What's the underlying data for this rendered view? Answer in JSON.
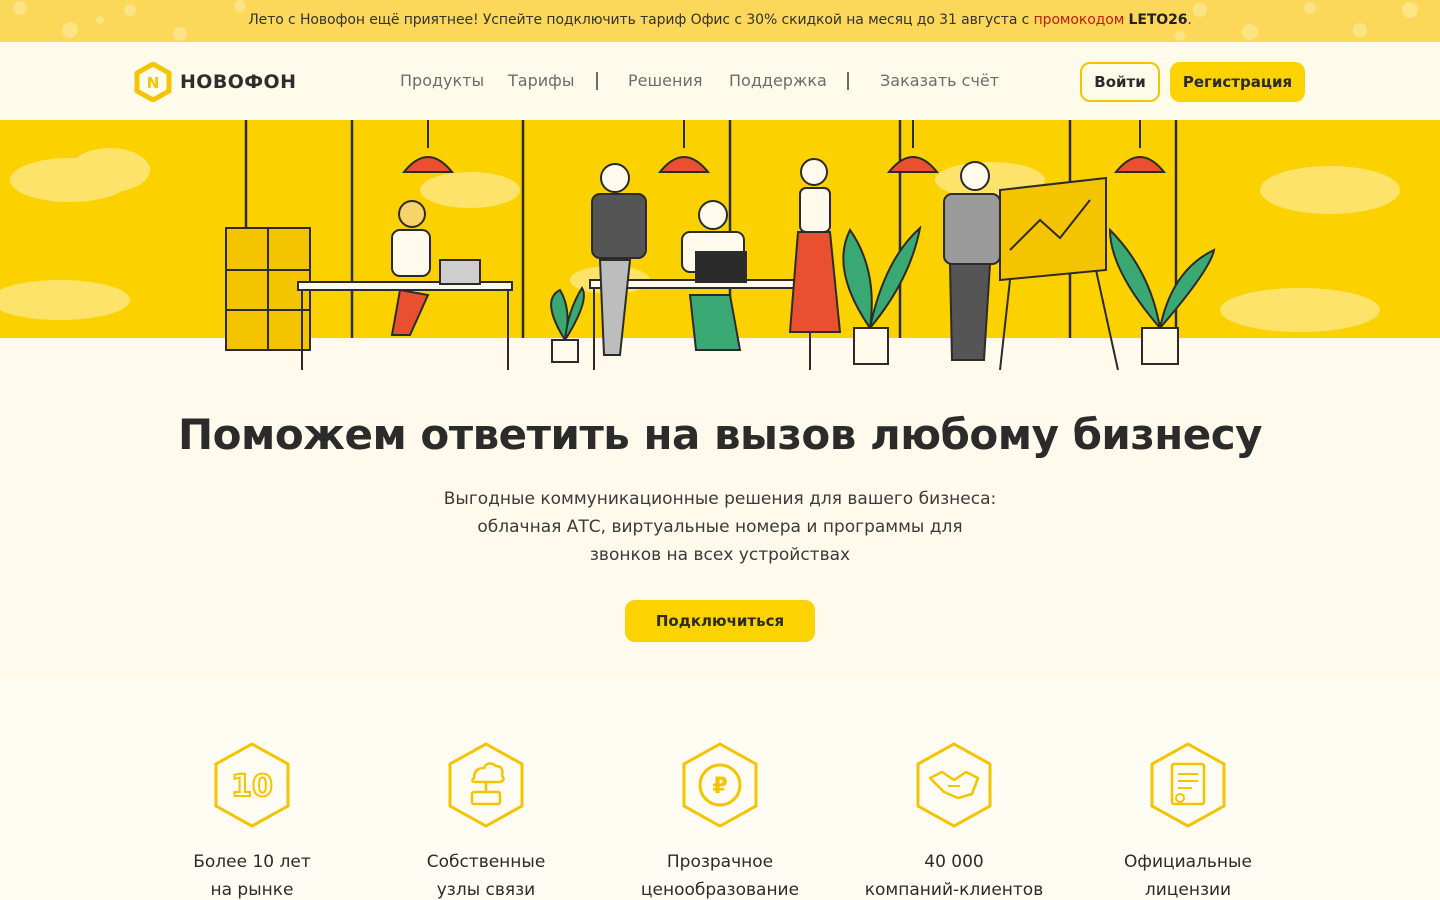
{
  "promo": {
    "text_before": "Лето с Новофон ещё приятнее! Успейте подключить тариф Офис с 30% скидкой на месяц до 31 августа с ",
    "link_text": "промокодом",
    "code": "LETO26",
    "text_after": "."
  },
  "header": {
    "logo_text": "НОВОФОН",
    "nav": [
      "Продукты",
      "Тарифы",
      "Решения",
      "Поддержка",
      "Заказать счёт"
    ],
    "login_label": "Войти",
    "register_label": "Регистрация"
  },
  "hero": {
    "title": "Поможем ответить на вызов любому бизнесу",
    "subtitle_lines": [
      "Выгодные коммуникационные решения для вашего бизнеса:",
      "облачная АТС, виртуальные номера и программы для",
      "звонков на всех устройствах"
    ],
    "cta_label": "Подключиться"
  },
  "features": [
    {
      "icon": "ten-years-icon",
      "line1": "Более 10 лет",
      "line2": "на рынке"
    },
    {
      "icon": "server-cloud-icon",
      "line1": "Собственные",
      "line2": "узлы связи"
    },
    {
      "icon": "ruble-coin-icon",
      "line1": "Прозрачное",
      "line2": "ценообразование"
    },
    {
      "icon": "handshake-icon",
      "line1": "40 000",
      "line2": "компаний-клиентов"
    },
    {
      "icon": "license-icon",
      "line1": "Официальные",
      "line2": "лицензии"
    }
  ],
  "colors": {
    "brand_yellow": "#fcd200",
    "accent_red": "#c21b17",
    "page_bg": "#fffaeb",
    "text": "#2b2b2b"
  }
}
